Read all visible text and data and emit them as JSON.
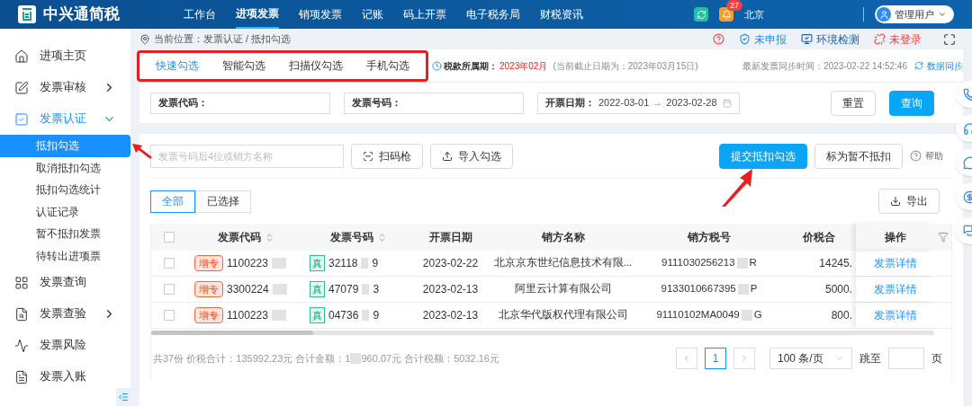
{
  "header": {
    "logo_text": "中兴通简税",
    "nav": [
      {
        "label": "工作台",
        "selected": false
      },
      {
        "label": "进项发票",
        "selected": true
      },
      {
        "label": "销项发票",
        "selected": false
      },
      {
        "label": "记账",
        "selected": false
      },
      {
        "label": "码上开票",
        "selected": false
      },
      {
        "label": "电子税务局",
        "selected": false
      },
      {
        "label": "财税资讯",
        "selected": false
      }
    ],
    "notification_count": "27",
    "company": "北京",
    "user": "管理用户"
  },
  "sidebar": {
    "items": [
      {
        "label": "进项主页",
        "selected": false
      },
      {
        "label": "发票审核",
        "selected": false,
        "expanded": false
      },
      {
        "label": "发票认证",
        "selected": true,
        "expanded": true,
        "children": [
          {
            "label": "抵扣勾选",
            "selected": true
          },
          {
            "label": "取消抵扣勾选",
            "selected": false
          },
          {
            "label": "抵扣勾选统计",
            "selected": false
          },
          {
            "label": "认证记录",
            "selected": false
          },
          {
            "label": "暂不抵扣发票",
            "selected": false
          },
          {
            "label": "待转出进项票",
            "selected": false
          }
        ]
      },
      {
        "label": "发票查询",
        "selected": false
      },
      {
        "label": "发票查验",
        "selected": false,
        "expanded": false
      },
      {
        "label": "发票风险",
        "selected": false
      },
      {
        "label": "发票入账",
        "selected": false
      }
    ]
  },
  "breadcrumb": "当前位置：发票认证 / 抵扣勾选",
  "top_actions": [
    {
      "kind": "help"
    },
    {
      "kind": "declare",
      "label": "未申报"
    },
    {
      "kind": "env",
      "label": "环境检测"
    },
    {
      "kind": "login",
      "label": "未登录"
    }
  ],
  "tabs": [
    {
      "label": "快速勾选",
      "selected": true
    },
    {
      "label": "智能勾选",
      "selected": false
    },
    {
      "label": "扫描仪勾选",
      "selected": false
    },
    {
      "label": "手机勾选",
      "selected": false
    }
  ],
  "period": {
    "label": "税款所属期：",
    "value": "2023年02月",
    "note": "(当前截止日期为：2023年03月15日)"
  },
  "sync": {
    "label": "最新发票同步时间：2023-02-22 14:52:46",
    "button": "数据同步"
  },
  "filters": {
    "code_label": "发票代码：",
    "number_label": "发票号码：",
    "date_label": "开票日期：",
    "date_start": "2022-03-01",
    "date_separator": "→",
    "date_end": "2023-02-28",
    "reset": "重置",
    "query": "查询"
  },
  "toolbar": {
    "search_placeholder": "发票号码后4位或销方名称",
    "scan": "扫码枪",
    "import": "导入勾选",
    "submit": "提交抵扣勾选",
    "mark": "标为暂不抵扣",
    "help": "帮助"
  },
  "view_tabs": [
    {
      "label": "全部",
      "selected": true
    },
    {
      "label": "已选择",
      "selected": false
    }
  ],
  "export": "导出",
  "table": {
    "all_checked": false,
    "columns": [
      "发票代码",
      "发票号码",
      "开票日期",
      "销方名称",
      "销方税号",
      "价税合",
      "操作"
    ],
    "rows": [
      {
        "checked": false,
        "type_tag": "增专",
        "code": "1100223",
        "verify_tag": "真",
        "number_head": "32118",
        "number_tail": "9",
        "date": "2023-02-22",
        "seller": "北京京东世纪信息技术有限...",
        "tax_id_head": "9111030256213",
        "tax_id_tail": "R",
        "amount": "14245.",
        "action": "发票详情"
      },
      {
        "checked": false,
        "type_tag": "增专",
        "code": "3300224",
        "verify_tag": "真",
        "number_head": "47079",
        "number_tail": "3",
        "date": "2023-02-13",
        "seller": "阿里云计算有限公司",
        "tax_id_head": "9133010667395",
        "tax_id_tail": "P",
        "amount": "5000.",
        "action": "发票详情"
      },
      {
        "checked": false,
        "type_tag": "增专",
        "code": "1100223",
        "verify_tag": "真",
        "number_head": "04736",
        "number_tail": "9",
        "date": "2023-02-13",
        "seller": "北京华代版权代理有限公司",
        "tax_id_head": "91110102MA0049",
        "tax_id_tail": "G",
        "amount": "800.",
        "action": "发票详情"
      }
    ]
  },
  "summary": {
    "before_blur": "共37份 价税合计：135992.23元 合计金额：1",
    "after_blur": "960.07元 合计税额：5032.16元"
  },
  "pagination": {
    "pages": [
      {
        "label": "1",
        "selected": true
      }
    ],
    "page_size": "100 条/页",
    "jump_label": "跳至",
    "page_unit": "页"
  }
}
